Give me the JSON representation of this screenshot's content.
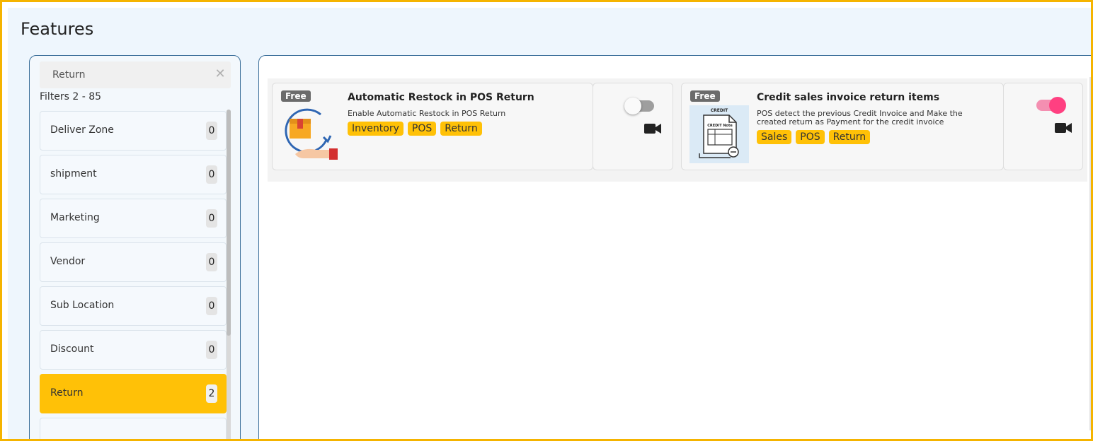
{
  "page": {
    "title": "Features"
  },
  "sidebar": {
    "search": {
      "value": "Return",
      "placeholder": ""
    },
    "filters_label": "Filters 2 - 85",
    "items": [
      {
        "label": "Deliver Zone",
        "count": "0",
        "active": false
      },
      {
        "label": "shipment",
        "count": "0",
        "active": false
      },
      {
        "label": "Marketing",
        "count": "0",
        "active": false
      },
      {
        "label": "Vendor",
        "count": "0",
        "active": false
      },
      {
        "label": "Sub Location",
        "count": "0",
        "active": false
      },
      {
        "label": "Discount",
        "count": "0",
        "active": false
      },
      {
        "label": "Return",
        "count": "2",
        "active": true
      }
    ]
  },
  "cards": [
    {
      "badge": "Free",
      "title": "Automatic Restock in POS Return",
      "description": "Enable Automatic Restock in POS Return",
      "tags": [
        "Inventory",
        "POS",
        "Return"
      ],
      "enabled": false,
      "icon": "restock-box-icon",
      "video_icon": "video-camera-icon"
    },
    {
      "badge": "Free",
      "title": "Credit sales invoice return items",
      "description": "POS detect the previous Credit Invoice and Make the created return as Payment for the credit invoice",
      "tags": [
        "Sales",
        "POS",
        "Return"
      ],
      "enabled": true,
      "icon": "credit-note-icon",
      "image_text": {
        "header": "CREDIT",
        "note": "CREDIT Note"
      },
      "video_icon": "video-camera-icon"
    }
  ],
  "colors": {
    "accent": "#ffc107",
    "frame": "#f5b400",
    "toggle_on": "#ff4081",
    "panel_border": "#3b6f9a",
    "badge": "#6b6b6b"
  }
}
